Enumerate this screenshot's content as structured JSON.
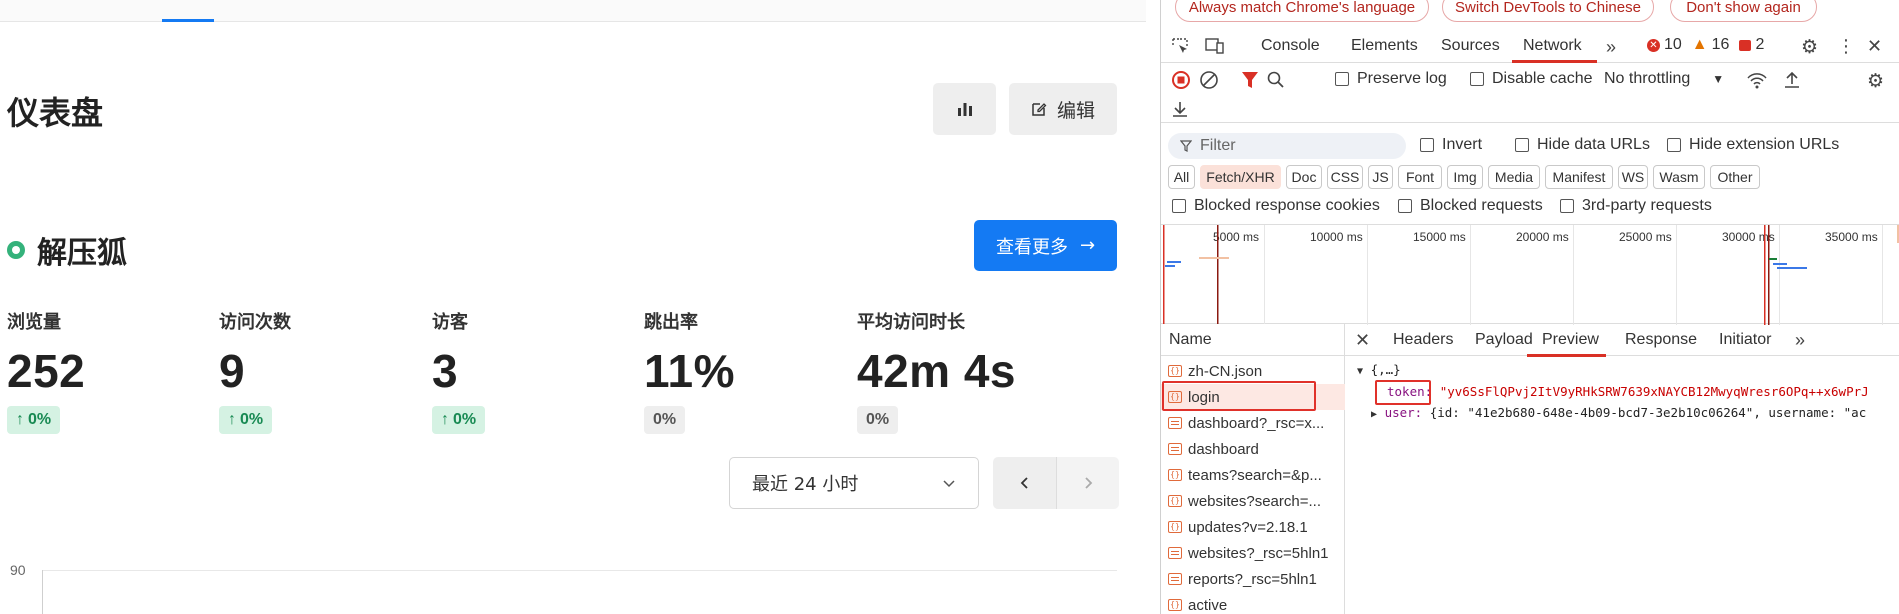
{
  "dashboard": {
    "title": "仪表盘",
    "edit_label": "编辑",
    "site_name": "解压狐",
    "view_more_label": "查看更多",
    "metrics": [
      {
        "label": "浏览量",
        "value": "252",
        "change": "0%",
        "trend": "up"
      },
      {
        "label": "访问次数",
        "value": "9",
        "change": "0%",
        "trend": "up"
      },
      {
        "label": "访客",
        "value": "3",
        "change": "0%",
        "trend": "up"
      },
      {
        "label": "跳出率",
        "value": "11%",
        "change": "0%",
        "trend": "flat"
      },
      {
        "label": "平均访问时长",
        "value": "42m 4s",
        "change": "0%",
        "trend": "flat"
      }
    ],
    "date_range": "最近 24 小时",
    "chart_y_tick": "90"
  },
  "devtools": {
    "infobar": {
      "match_language": "Always match Chrome's language",
      "switch_chinese": "Switch DevTools to Chinese",
      "dont_show": "Don't show again"
    },
    "tabs": [
      "Console",
      "Elements",
      "Sources",
      "Network"
    ],
    "active_tab": "Network",
    "errors": "10",
    "warnings": "16",
    "messages": "2",
    "preserve_log": "Preserve log",
    "disable_cache": "Disable cache",
    "throttling": "No throttling",
    "filter_placeholder": "Filter",
    "invert": "Invert",
    "hide_data_urls": "Hide data URLs",
    "hide_extension_urls": "Hide extension URLs",
    "type_filters": [
      "All",
      "Fetch/XHR",
      "Doc",
      "CSS",
      "JS",
      "Font",
      "Img",
      "Media",
      "Manifest",
      "WS",
      "Wasm",
      "Other"
    ],
    "active_type_filter": "Fetch/XHR",
    "blocked_response_cookies": "Blocked response cookies",
    "blocked_requests": "Blocked requests",
    "third_party": "3rd-party requests",
    "timeline_labels": [
      "5000 ms",
      "10000 ms",
      "15000 ms",
      "20000 ms",
      "25000 ms",
      "30000 ms",
      "35000 ms"
    ],
    "name_header": "Name",
    "requests": [
      {
        "name": "zh-CN.json",
        "type": "xhr"
      },
      {
        "name": "login",
        "type": "xhr",
        "selected": true
      },
      {
        "name": "dashboard?_rsc=x...",
        "type": "doc"
      },
      {
        "name": "dashboard",
        "type": "doc"
      },
      {
        "name": "teams?search=&p...",
        "type": "xhr"
      },
      {
        "name": "websites?search=...",
        "type": "xhr"
      },
      {
        "name": "updates?v=2.18.1",
        "type": "xhr"
      },
      {
        "name": "websites?_rsc=5hln1",
        "type": "doc"
      },
      {
        "name": "reports?_rsc=5hln1",
        "type": "doc"
      },
      {
        "name": "active",
        "type": "xhr"
      }
    ],
    "detail_tabs": [
      "Headers",
      "Payload",
      "Preview",
      "Response",
      "Initiator"
    ],
    "active_detail_tab": "Preview",
    "preview": {
      "root": "{,…}",
      "token_key": "token:",
      "token_value": "\"yv6SsFlQPvj2ItV9yRHkSRW7639xNAYCB12MwyqWresr6OPq++x6wPrJ",
      "user_key": "user:",
      "user_value": "{id: \"41e2b680-648e-4b09-bcd7-3e2b10c06264\", username: \"ac"
    }
  }
}
